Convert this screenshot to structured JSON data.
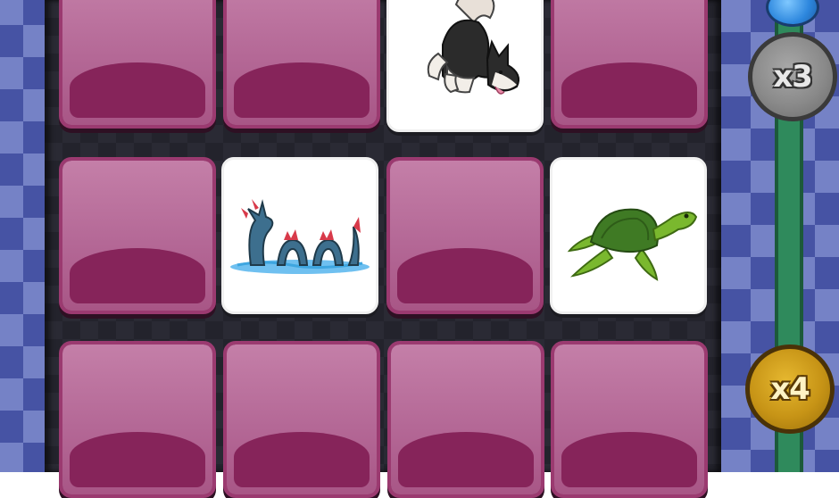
{
  "multipliers": {
    "silver_label": "x3",
    "gold_label": "x4"
  },
  "cards": [
    {
      "row": 0,
      "col": 0,
      "state": "face-down"
    },
    {
      "row": 0,
      "col": 1,
      "state": "face-down"
    },
    {
      "row": 0,
      "col": 2,
      "state": "face-up",
      "picture": "husky-dog"
    },
    {
      "row": 0,
      "col": 3,
      "state": "face-down"
    },
    {
      "row": 1,
      "col": 0,
      "state": "face-down"
    },
    {
      "row": 1,
      "col": 1,
      "state": "face-up",
      "picture": "sea-serpent"
    },
    {
      "row": 1,
      "col": 2,
      "state": "face-down"
    },
    {
      "row": 1,
      "col": 3,
      "state": "face-up",
      "picture": "sea-turtle"
    },
    {
      "row": 2,
      "col": 0,
      "state": "face-down"
    },
    {
      "row": 2,
      "col": 1,
      "state": "face-down"
    },
    {
      "row": 2,
      "col": 2,
      "state": "face-down"
    },
    {
      "row": 2,
      "col": 3,
      "state": "face-down"
    }
  ],
  "colors": {
    "card_back": "#8a2a5e",
    "checker_light": "#6e7cc4",
    "checker_dark": "#3d4aa0",
    "track": "#2f8a5c"
  }
}
